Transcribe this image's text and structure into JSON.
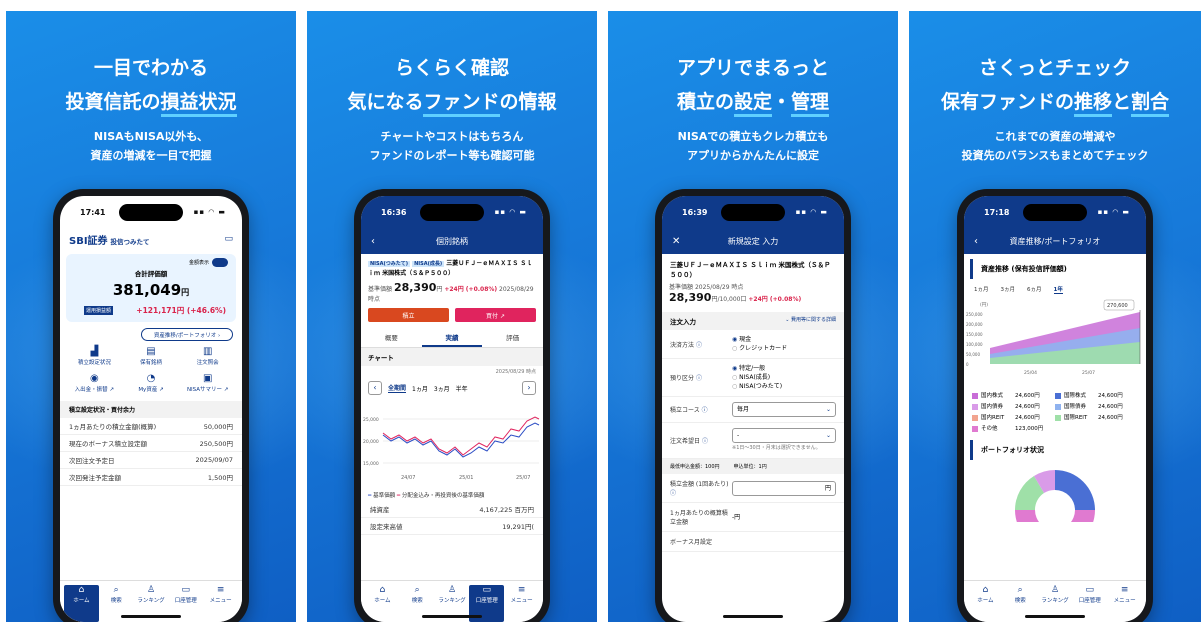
{
  "panels": [
    {
      "headline": {
        "line1": "一目でわかる",
        "line2_pre": "投資信託の",
        "line2_hl": "損益状況",
        "line2_post": ""
      },
      "sub": {
        "line1": "NISAもNISA以外も、",
        "line2": "資産の増減を一目で把握"
      },
      "screen": {
        "time": "17:41",
        "brand": "SBI証券",
        "app": "投信つみたて",
        "toggle_label": "金額表示",
        "total_caption": "合計評価額",
        "total_value": "381,049",
        "currency": "円",
        "gain_tag": "運用損益額",
        "gain": "+121,171円 (+46.6%)",
        "portfolio_btn": "資産推移/ポートフォリオ ›",
        "grid": [
          {
            "icon": "▟",
            "label": "積立設定状況",
            "name": "accumulation-status-icon"
          },
          {
            "icon": "▤",
            "label": "保有銘柄",
            "name": "holdings-icon"
          },
          {
            "icon": "▥",
            "label": "注文照会",
            "name": "order-inquiry-icon"
          },
          {
            "icon": "◉",
            "label": "入出金・振替 ↗",
            "name": "deposit-icon"
          },
          {
            "icon": "◔",
            "label": "My資産 ↗",
            "name": "my-assets-icon"
          },
          {
            "icon": "▣",
            "label": "NISAサマリー ↗",
            "name": "nisa-summary-icon"
          }
        ],
        "section": "積立設定状況・買付余力",
        "rows": [
          {
            "k": "1ヵ月あたりの積立金額(概算)",
            "v": "50,000円"
          },
          {
            "k": "現在のボーナス積立設定額",
            "v": "250,500円"
          },
          {
            "k": "次回注文予定日",
            "v": "2025/09/07"
          },
          {
            "k": "次回発注予定金額",
            "v": "1,500円"
          }
        ]
      }
    },
    {
      "headline": {
        "line1": "らくらく確認",
        "line2_pre": "気になる",
        "line2_hl": "ファンド",
        "line2_post": "の情報"
      },
      "sub": {
        "line1": "チャートやコストはもちろん",
        "line2": "ファンドのレポート等も確認可能"
      },
      "screen": {
        "time": "16:36",
        "nav_title": "個別銘柄",
        "tag1": "NISA(つみたて)",
        "tag2": "NISA(成長)",
        "fund": "三菱ＵＦＪ－ｅＭＡＸＩＳ Ｓｌｉｍ 米国株式（Ｓ＆Ｐ５００）",
        "price_label": "基準価額",
        "price": "28,390",
        "price_unit": "円",
        "change": "+24円 (+0.08%)",
        "price_date": "2025/08/29 時点",
        "btn_invest": "積立",
        "btn_buy": "買付 ↗",
        "tabs": [
          "概要",
          "実績",
          "評価"
        ],
        "chart_title": "チャート",
        "chart_date": "2025/08/29 時点",
        "periods": [
          "全期間",
          "1ヵ月",
          "3ヵ月",
          "半年"
        ],
        "legend1": "基準価額",
        "legend2": "分配金込み・再投資後の基準価額",
        "rows": [
          {
            "k": "純資産",
            "v": "4,167,225 百万円"
          },
          {
            "k": "設定来高値",
            "v": "19,291円("
          }
        ]
      }
    },
    {
      "headline": {
        "line1": "アプリでまるっと",
        "line2_pre": "積立の",
        "line2_hl": "設定",
        "line2_mid": "・",
        "line2_hl2": "管理",
        "line2_post": ""
      },
      "sub": {
        "line1": "NISAでの積立もクレカ積立も",
        "line2": "アプリからかんたんに設定"
      },
      "screen": {
        "time": "16:39",
        "nav_title": "新規設定 入力",
        "fund": "三菱ＵＦＪ－ｅＭＡＸＩＳ Ｓｌｉｍ 米国株式（Ｓ＆Ｐ５００）",
        "price_label": "基準価額",
        "price_date": "2025/08/29 時点",
        "price": "28,390",
        "price_unit": "円/10,000口",
        "change": "+24円 (+0.08%)",
        "section": "注文入力",
        "section_link": "費用等に関する詳細",
        "pay_label": "決済方法",
        "pay_opts": [
          "現金",
          "クレジットカード"
        ],
        "acct_label": "預り区分",
        "acct_opts": [
          "特定/一般",
          "NISA(成長)",
          "NISA(つみたて)"
        ],
        "course_label": "積立コース",
        "course_value": "毎月",
        "day_label": "注文希望日",
        "day_value": "-",
        "day_note": "※1日～30日・月末は選択できません。",
        "min_label": "最低申込金額：100円",
        "unit_label": "申込単位：1円",
        "amount_label": "積立金額 (1回あたり)",
        "amount_unit": "円",
        "monthly_label": "1ヵ月あたりの概算積立金額",
        "monthly_value": "-円",
        "bonus_label": "ボーナス月設定"
      }
    },
    {
      "headline": {
        "line1": "さくっとチェック",
        "line2_pre": "保有ファンドの",
        "line2_hl": "推移",
        "line2_mid": "と",
        "line2_hl2": "割合",
        "line2_post": ""
      },
      "sub": {
        "line1": "これまでの資産の増減や",
        "line2": "投資先のバランスもまとめてチェック"
      },
      "screen": {
        "time": "17:18",
        "nav_title": "資産推移/ポートフォリオ",
        "section1": "資産推移 (保有投信評価額)",
        "ranges": [
          "1ヵ月",
          "3ヵ月",
          "6ヵ月",
          "1年"
        ],
        "y_unit": "(円)",
        "peak_label": "270,600",
        "y_ticks": [
          "250,000",
          "200,000",
          "150,000",
          "100,000",
          "50,000",
          "0"
        ],
        "x_ticks": [
          "25/04",
          "25/07"
        ],
        "legend": [
          {
            "name": "国内株式",
            "value": "24,600円",
            "color": "#c86dd7"
          },
          {
            "name": "国際株式",
            "value": "24,600円",
            "color": "#4a6fd4"
          },
          {
            "name": "国内債券",
            "value": "24,600円",
            "color": "#d99be8"
          },
          {
            "name": "国際債券",
            "value": "24,600円",
            "color": "#8fb2ef"
          },
          {
            "name": "国内REIT",
            "value": "24,600円",
            "color": "#f2a48f"
          },
          {
            "name": "国際REIT",
            "value": "24,600円",
            "color": "#9fe0a8"
          },
          {
            "name": "その他",
            "value": "123,000円",
            "color": "#e07ad0"
          }
        ],
        "section2": "ポートフォリオ状況"
      }
    }
  ],
  "tabbar": [
    {
      "icon": "⌂",
      "label": "ホーム",
      "name": "home-icon"
    },
    {
      "icon": "⌕",
      "label": "検索",
      "name": "search-icon"
    },
    {
      "icon": "♙",
      "label": "ランキング",
      "name": "ranking-icon"
    },
    {
      "icon": "▭",
      "label": "口座管理",
      "name": "account-icon"
    },
    {
      "icon": "≡",
      "label": "メニュー",
      "name": "menu-icon"
    }
  ],
  "colors": {
    "navy": "#0f3a8a",
    "accent_red": "#d9234b",
    "bg_blue": "#1779d9"
  }
}
